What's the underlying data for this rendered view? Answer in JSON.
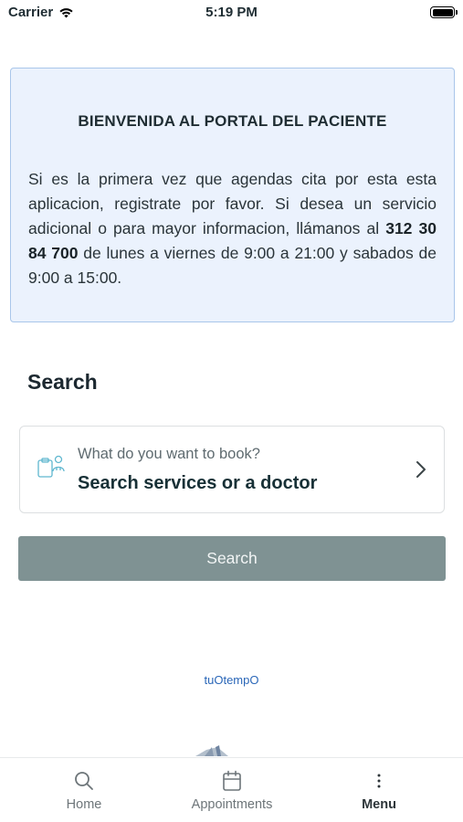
{
  "status_bar": {
    "carrier": "Carrier",
    "time": "5:19 PM"
  },
  "welcome": {
    "title": "BIENVENIDA AL PORTAL DEL PACIENTE",
    "text_before": "Si es la primera vez que agendas cita por esta esta aplicacion, registrate por favor. Si desea un servicio adicional o para mayor informacion, llámanos al ",
    "phone": "312 30 84 700",
    "text_after": " de lunes a viernes de 9:00 a 21:00 y sabados de 9:00 a 15:00."
  },
  "search": {
    "heading": "Search",
    "prompt": "What do you want to book?",
    "main_label": "Search services or a doctor",
    "button_label": "Search"
  },
  "brand": {
    "link_text": "tuOtempO"
  },
  "tab_bar": {
    "tabs": [
      {
        "label": "Home",
        "icon": "search-icon",
        "active": false
      },
      {
        "label": "Appointments",
        "icon": "calendar-icon",
        "active": false
      },
      {
        "label": "Menu",
        "icon": "more-vertical-icon",
        "active": true
      }
    ]
  },
  "colors": {
    "card_background": "#ebf2fd",
    "card_border": "#a9c6ea",
    "button": "#7f9293",
    "link": "#2b67b8"
  }
}
